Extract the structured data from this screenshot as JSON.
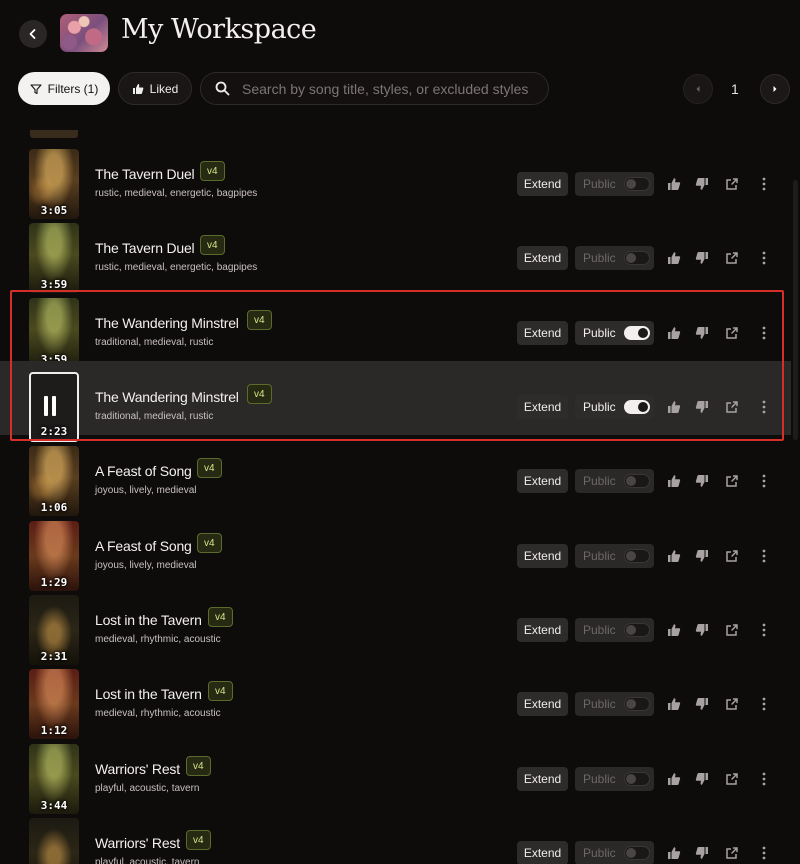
{
  "header": {
    "title": "My Workspace"
  },
  "toolbar": {
    "filters_label": "Filters (1)",
    "liked_label": "Liked",
    "search_placeholder": "Search by song title, styles, or excluded styles",
    "page": "1"
  },
  "songs": [
    {
      "title": "The Tavern Duel",
      "version": "v4",
      "tags": "rustic, medieval, energetic, bagpipes",
      "duration": "3:05",
      "public": false
    },
    {
      "title": "The Tavern Duel",
      "version": "v4",
      "tags": "rustic, medieval, energetic, bagpipes",
      "duration": "3:59",
      "public": false
    },
    {
      "title": "The Wandering Minstrel",
      "version": "v4",
      "tags": "traditional, medieval, rustic",
      "duration": "3:59",
      "public": true
    },
    {
      "title": "The Wandering Minstrel",
      "version": "v4",
      "tags": "traditional, medieval, rustic",
      "duration": "2:23",
      "public": true,
      "playing": true
    },
    {
      "title": "A Feast of Song",
      "version": "v4",
      "tags": "joyous, lively, medieval",
      "duration": "1:06",
      "public": false
    },
    {
      "title": "A Feast of Song",
      "version": "v4",
      "tags": "joyous, lively, medieval",
      "duration": "1:29",
      "public": false
    },
    {
      "title": "Lost in the Tavern",
      "version": "v4",
      "tags": "medieval, rhythmic, acoustic",
      "duration": "2:31",
      "public": false
    },
    {
      "title": "Lost in the Tavern",
      "version": "v4",
      "tags": "medieval, rhythmic, acoustic",
      "duration": "1:12",
      "public": false
    },
    {
      "title": "Warriors' Rest",
      "version": "v4",
      "tags": "playful, acoustic, tavern",
      "duration": "3:44",
      "public": false
    },
    {
      "title": "Warriors' Rest",
      "version": "v4",
      "tags": "playful, acoustic, tavern",
      "duration": "",
      "public": false
    }
  ],
  "row_actions": {
    "extend_label": "Extend",
    "public_label": "Public"
  },
  "icons": {
    "back": "chevron-left-icon",
    "filter": "filter-icon",
    "liked": "thumbs-up-icon",
    "search": "search-icon",
    "prev": "chevron-left-icon",
    "next": "chevron-right-icon",
    "like": "thumbs-up-icon",
    "dislike": "thumbs-down-icon",
    "share": "share-icon",
    "more": "more-vertical-icon"
  },
  "colors": {
    "background": "#0e0b0b",
    "badge_text": "#d8e68a",
    "highlight": "#d62f2a"
  }
}
